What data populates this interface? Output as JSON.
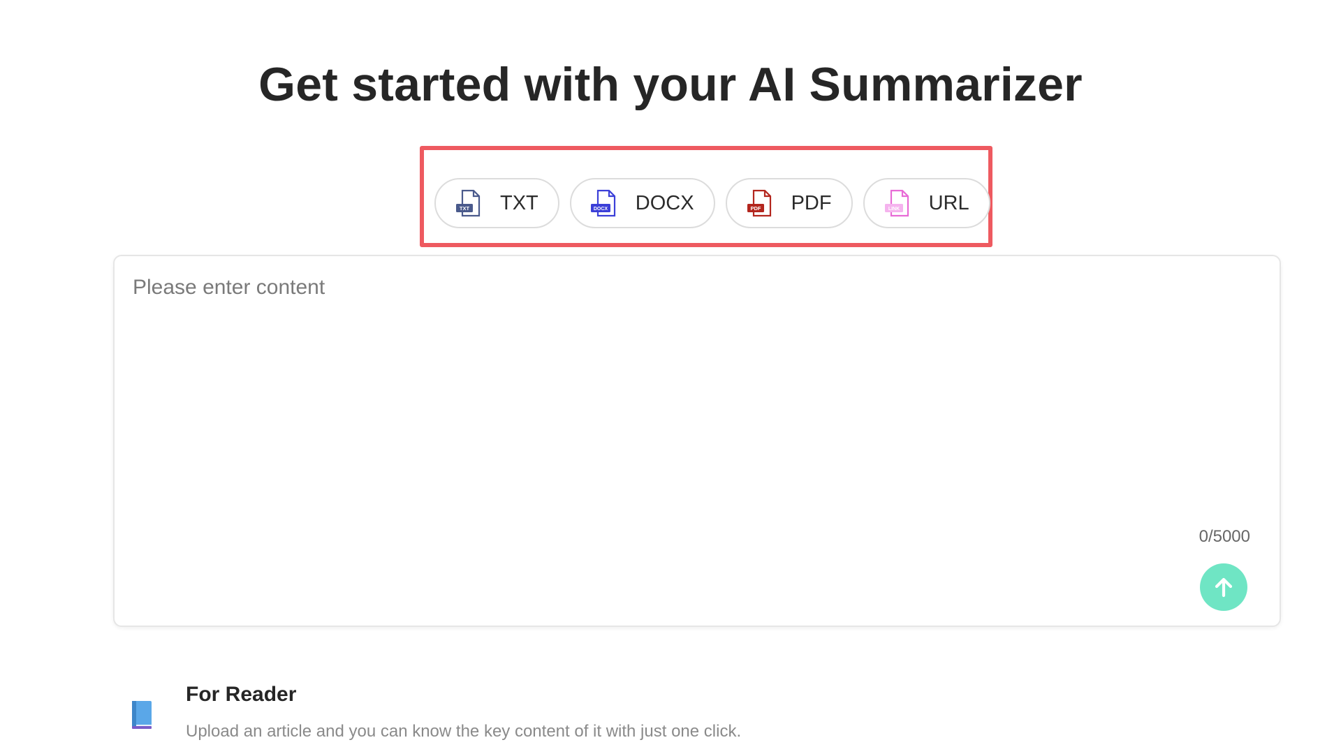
{
  "page": {
    "title": "Get started with your AI Summarizer"
  },
  "upload_options": [
    {
      "label": "TXT",
      "icon": "txt-file-icon",
      "tag": "TXT",
      "color": "#4a5a8c"
    },
    {
      "label": "DOCX",
      "icon": "docx-file-icon",
      "tag": "DOCX",
      "color": "#3b3fd8"
    },
    {
      "label": "PDF",
      "icon": "pdf-file-icon",
      "tag": "PDF",
      "color": "#b3261e"
    },
    {
      "label": "URL",
      "icon": "link-file-icon",
      "tag": "LINK",
      "color": "#e86bd6"
    }
  ],
  "editor": {
    "placeholder": "Please enter content",
    "value": "",
    "counter": "0/5000",
    "submit_icon": "arrow-up-icon",
    "submit_color": "#6fe5c4"
  },
  "feature": {
    "icon": "blue-book-icon",
    "title": "For Reader",
    "description": "Upload an article and you can know the key content of it with just one click."
  },
  "colors": {
    "highlight_border": "#ee5a60"
  }
}
